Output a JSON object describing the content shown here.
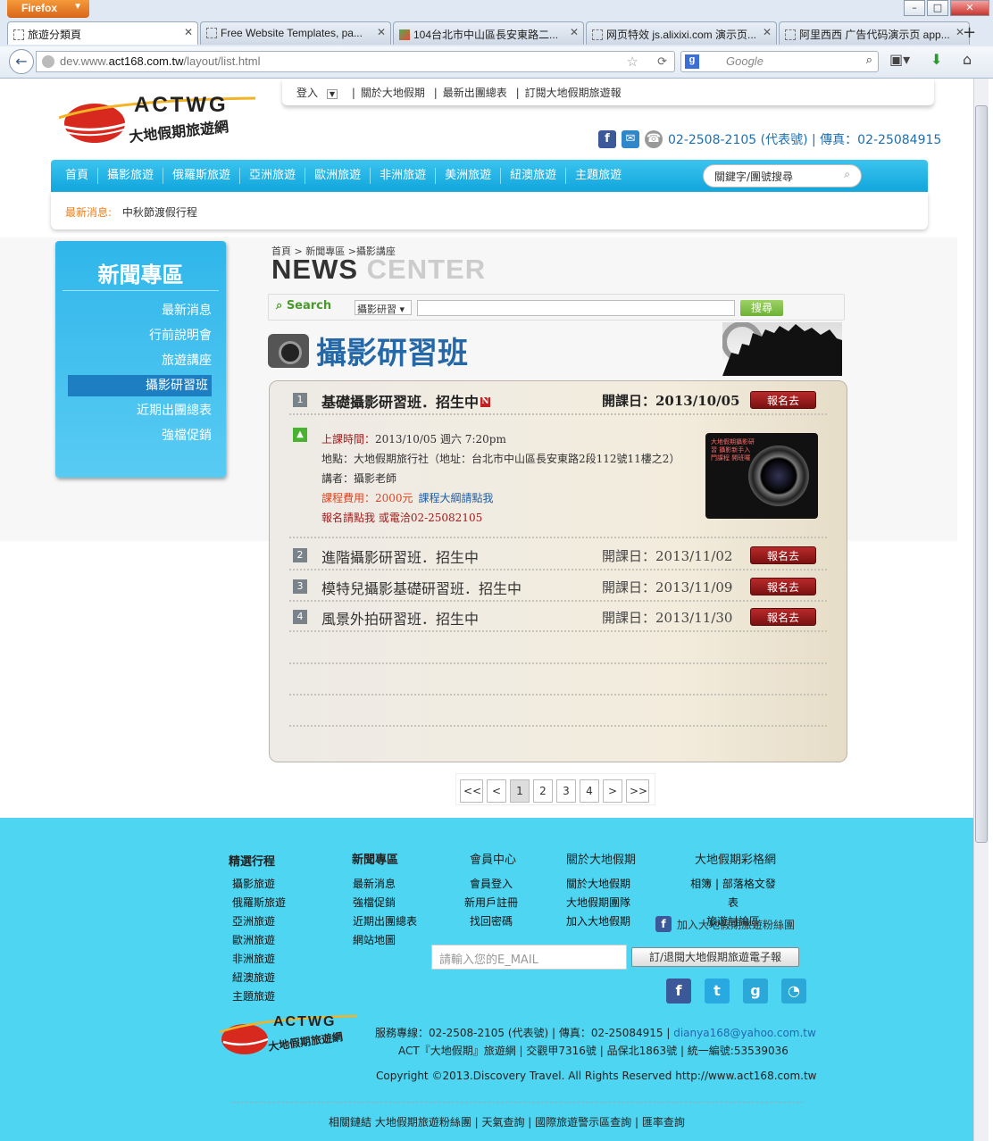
{
  "browser": {
    "app_button": "Firefox",
    "tabs": [
      {
        "title": "旅遊分類頁",
        "active": true
      },
      {
        "title": "Free Website Templates, pa..."
      },
      {
        "title": "104台北市中山區長安東路二..."
      },
      {
        "title": "网页特效 js.alixixi.com 演示页..."
      },
      {
        "title": "阿里西西 广告代码演示页 app..."
      }
    ],
    "url_prefix": "dev.www.",
    "url_domain": "act168.com.tw",
    "url_path": "/layout/list.html",
    "search_engine": "Google"
  },
  "header": {
    "logo_text": "ACTWG",
    "logo_sub": "大地假期旅遊網",
    "top_links": [
      "登入",
      "關於大地假期",
      "最新出團總表",
      "訂閱大地假期旅遊報"
    ],
    "phone": "02-2508-2105 (代表號) | 傳真：02-25084915",
    "icons": [
      "facebook-icon",
      "mail-icon",
      "phone-icon"
    ]
  },
  "main_nav": {
    "items": [
      "首頁",
      "攝影旅遊",
      "俄羅斯旅遊",
      "亞洲旅遊",
      "歐洲旅遊",
      "非洲旅遊",
      "美洲旅遊",
      "紐澳旅遊",
      "主題旅遊"
    ],
    "search_placeholder": "關鍵字/團號搜尋"
  },
  "ticker": {
    "label": "最新消息:",
    "text": "中秋節渡假行程"
  },
  "sidebar": {
    "title": "新聞專區",
    "items": [
      "最新消息",
      "行前說明會",
      "旅遊講座",
      "攝影研習班",
      "近期出團總表",
      "強檔促銷"
    ],
    "active_index": 3
  },
  "content": {
    "breadcrumb": [
      "首頁",
      "新聞專區",
      "攝影講座"
    ],
    "news_title_a": "NEWS",
    "news_title_b": "CENTER",
    "search_label": "Search",
    "search_select": "攝影研習",
    "search_button": "搜尋",
    "section_title": "攝影研習班",
    "courses": [
      {
        "num": "1",
        "title": "基礎攝影研習班．招生中",
        "badge": "N",
        "date_label": "開課日：2013/10/05",
        "button": "報名去"
      },
      {
        "num": "2",
        "title": "進階攝影研習班．招生中",
        "date_label": "開課日：2013/11/02",
        "button": "報名去"
      },
      {
        "num": "3",
        "title": "模特兒攝影基礎研習班．招生中",
        "date_label": "開課日：2013/11/09",
        "button": "報名去"
      },
      {
        "num": "4",
        "title": "風景外拍研習班．招生中",
        "date_label": "開課日：2013/11/30",
        "button": "報名去"
      }
    ],
    "detail": {
      "time_label": "上課時間：",
      "time_value": "2013/10/05 週六 7:20pm",
      "place": "地點：大地假期旅行社（地址：台北市中山區長安東路2段112號11樓之2）",
      "speaker": "講者：攝影老師",
      "fee_label": "課程費用：2000元",
      "outline_link": "課程大綱請點我",
      "signup": "報名請點我 或電洽02-25082105",
      "image_caption": "大地假期攝影研習 攝影新手入門課程 開班囉"
    },
    "pager": [
      "<<",
      "<",
      "1",
      "2",
      "3",
      "4",
      ">",
      ">>"
    ],
    "current_page": "1"
  },
  "footer": {
    "col1": {
      "title": "精選行程",
      "items": [
        "攝影旅遊",
        "俄羅斯旅遊",
        "亞洲旅遊",
        "歐洲旅遊",
        "非洲旅遊",
        "紐澳旅遊",
        "主題旅遊"
      ]
    },
    "col2": {
      "title": "新聞專區",
      "items": [
        "最新消息",
        "強檔促銷",
        "近期出團總表",
        "網站地圖"
      ]
    },
    "col3": {
      "title": "會員中心",
      "items": [
        "會員登入",
        "新用戶註冊",
        "找回密碼"
      ]
    },
    "col4": {
      "title": "關於大地假期",
      "items": [
        "關於大地假期",
        "大地假期團隊",
        "加入大地假期"
      ]
    },
    "col5": {
      "title": "大地假期彩格網",
      "items": [
        "相簿 | 部落格文發表",
        "旅遊討論區"
      ],
      "fb_text": "加入大地假期旅遊粉絲團"
    },
    "email_placeholder": "請輸入您的E_MAIL",
    "subscribe_button": "訂/退閱大地假期旅遊電子報",
    "info_line1": "服務專線：02-2508-2105 (代表號) | 傳真：02-25084915 |",
    "info_email": "dianya168@yahoo.com.tw",
    "info_line2": "ACT『大地假期』旅遊網 | 交觀甲7316號 | 品保北1863號 | 統一編號:53539036",
    "copyright": "Copyright ©2013.Discovery Travel. All Rights Reserved http://www.act168.com.tw",
    "related": "相關鏈結 大地假期旅遊粉絲團 | 天氣查詢 | 國際旅遊警示區查詢 | 匯率查詢"
  }
}
